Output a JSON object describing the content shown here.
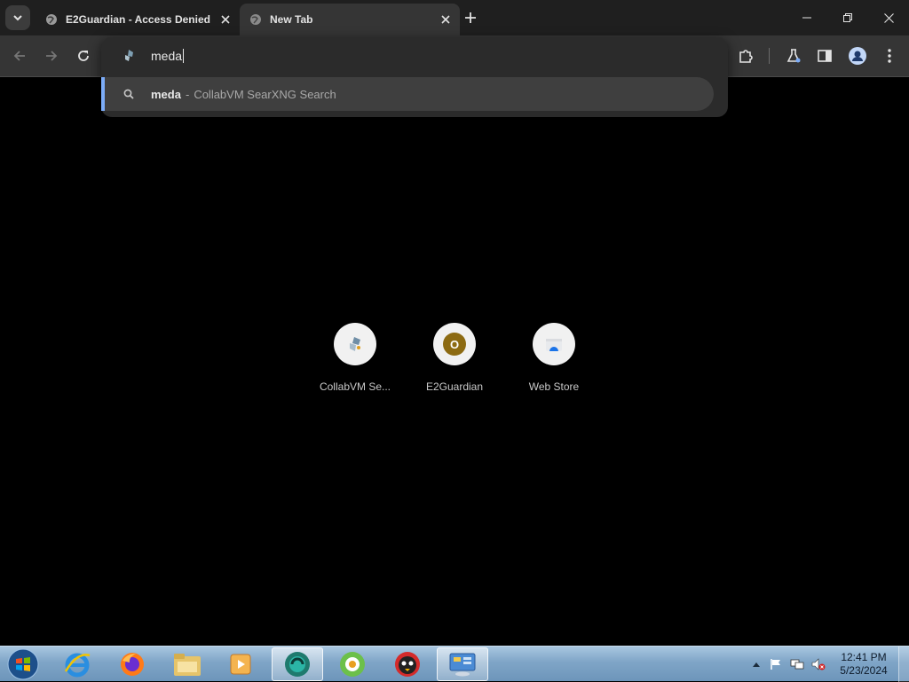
{
  "browser": {
    "tabs": [
      {
        "title": "E2Guardian - Access Denied",
        "active": false
      },
      {
        "title": "New Tab",
        "active": true
      }
    ],
    "omnibox": {
      "value": "meda",
      "suggestion": {
        "query": "meda",
        "separator": "-",
        "description": "CollabVM SearXNG Search"
      }
    },
    "shortcuts": [
      {
        "label": "CollabVM Se...",
        "icon": "collabvm-icon"
      },
      {
        "label": "E2Guardian",
        "icon": "letter-o-icon",
        "letter": "O",
        "color": "#8c6a12"
      },
      {
        "label": "Web Store",
        "icon": "web-store-icon"
      }
    ]
  },
  "taskbar": {
    "apps": [
      "internet-explorer-icon",
      "firefox-icon",
      "file-explorer-icon",
      "media-player-icon",
      "collabvm-app-icon",
      "green-app-icon",
      "bird-app-icon",
      "control-panel-icon"
    ],
    "clock": {
      "time": "12:41 PM",
      "date": "5/23/2024"
    }
  },
  "colors": {
    "accent": "#7cacf8",
    "toolbar": "#353535",
    "tabstrip": "#1f1f1f",
    "popup": "#2b2b2b"
  }
}
